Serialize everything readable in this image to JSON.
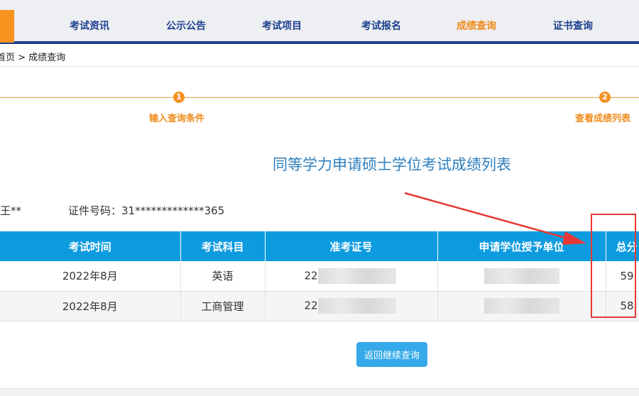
{
  "nav": {
    "items": [
      {
        "label": "考试资讯"
      },
      {
        "label": "公示公告"
      },
      {
        "label": "考试项目"
      },
      {
        "label": "考试报名"
      },
      {
        "label": "成绩查询"
      },
      {
        "label": "证书查询"
      }
    ],
    "active": "成绩查询"
  },
  "breadcrumb": "首页 > 成绩查询",
  "steps": [
    {
      "number": "1",
      "label": "输入查询条件"
    },
    {
      "number": "2",
      "label": "查看成绩列表"
    }
  ],
  "title": "同等学力申请硕士学位考试成绩列表",
  "info": {
    "name": "王**",
    "id_label": "证件号码：",
    "id_value": "31*************365"
  },
  "table": {
    "headers": [
      "考试时间",
      "考试科目",
      "准考证号",
      "申请学位授予单位",
      "总分"
    ],
    "rows": [
      {
        "date": "2022年8月",
        "subject": "英语",
        "ticket": "22",
        "score": "59"
      },
      {
        "date": "2022年8月",
        "subject": "工商管理",
        "ticket": "22",
        "score": "58"
      }
    ]
  },
  "button": {
    "back_label": "返回继续查询"
  },
  "colors": {
    "nav_text": "#1b3f8f",
    "accent_orange": "#f08c1c",
    "table_header": "#0d9be0",
    "title_blue": "#2f7fbd",
    "button": "#35a9e9",
    "annotation_red": "#e53935"
  }
}
